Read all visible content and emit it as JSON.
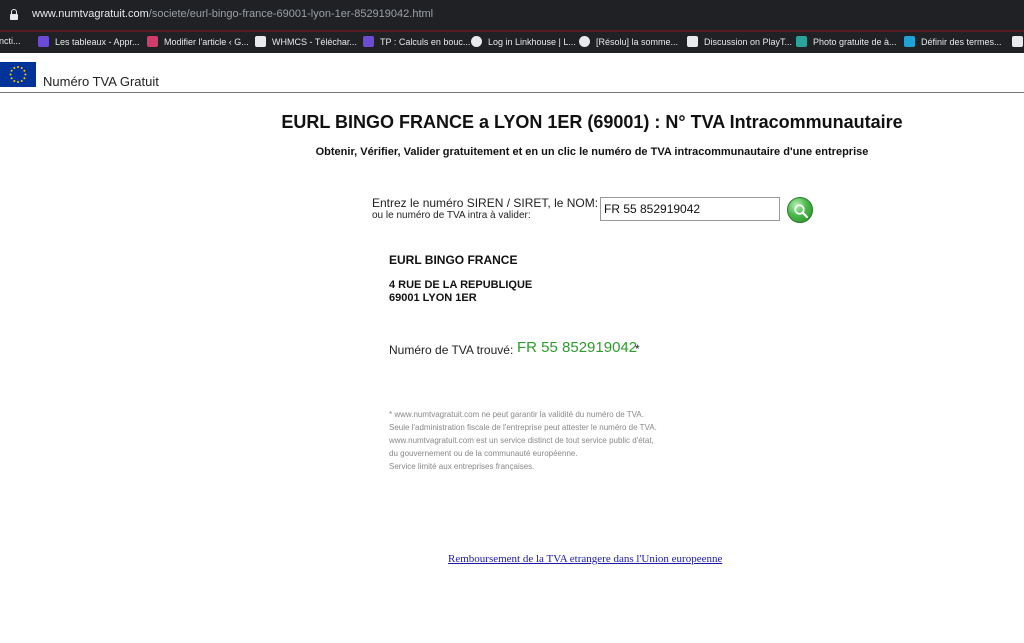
{
  "browser": {
    "url_host": "www.numtvagratuit.com",
    "url_path": "/societe/eurl-bingo-france-69001-lyon-1er-852919042.html",
    "bookmarks": [
      {
        "label": "oncti...",
        "color": "#202124"
      },
      {
        "label": "Les tableaux - Appr...",
        "color": "#6a4cd6"
      },
      {
        "label": "Modifier l'article ‹ G...",
        "color": "#d23b6a"
      },
      {
        "label": "WHMCS - Téléchar...",
        "color": "#e8eaed"
      },
      {
        "label": "TP : Calculs en bouc...",
        "color": "#6a4cd6"
      },
      {
        "label": "Log in Linkhouse | L...",
        "color": "#e8eaed"
      },
      {
        "label": "[Résolu] la somme...",
        "color": "#e8eaed"
      },
      {
        "label": "Discussion on PlayT...",
        "color": "#e8eaed"
      },
      {
        "label": "Photo gratuite de à...",
        "color": "#2aa39a"
      },
      {
        "label": "Définir des termes...",
        "color": "#1fa3d6"
      },
      {
        "label": "",
        "color": "#e8eaed"
      }
    ]
  },
  "site": {
    "name": "Numéro TVA Gratuit"
  },
  "page": {
    "title": "EURL BINGO FRANCE a LYON 1ER (69001) : N° TVA Intracommunautaire",
    "subtitle": "Obtenir, Vérifier, Valider gratuitement et en un clic le numéro de TVA intracommunautaire d'une entreprise"
  },
  "search": {
    "label_line1": "Entrez le numéro SIREN / SIRET, le NOM:",
    "label_line2": "ou le numéro de TVA intra à valider:",
    "value": "FR 55 852919042"
  },
  "company": {
    "name": "EURL BINGO FRANCE",
    "address_line1": "4 RUE DE LA REPUBLIQUE",
    "address_line2": "69001 LYON 1ER"
  },
  "tva": {
    "label": "Numéro de TVA trouvé:",
    "value": "FR 55 852919042",
    "star": "*",
    "color": "#2f9a2f"
  },
  "disclaimer": [
    "* www.numtvagratuit.com ne peut garantir la validité du numéro de TVA.",
    "Seule l'administration fiscale de l'entreprise peut attester le numéro de TVA.",
    "www.numtvagratuit.com est un service distinct de tout service public d'état,",
    "du gouvernement ou de la communauté européenne.",
    "Service limité aux entreprises françaises."
  ],
  "footer": {
    "link": "Remboursement de la TVA etrangere dans l'Union europeenne"
  }
}
